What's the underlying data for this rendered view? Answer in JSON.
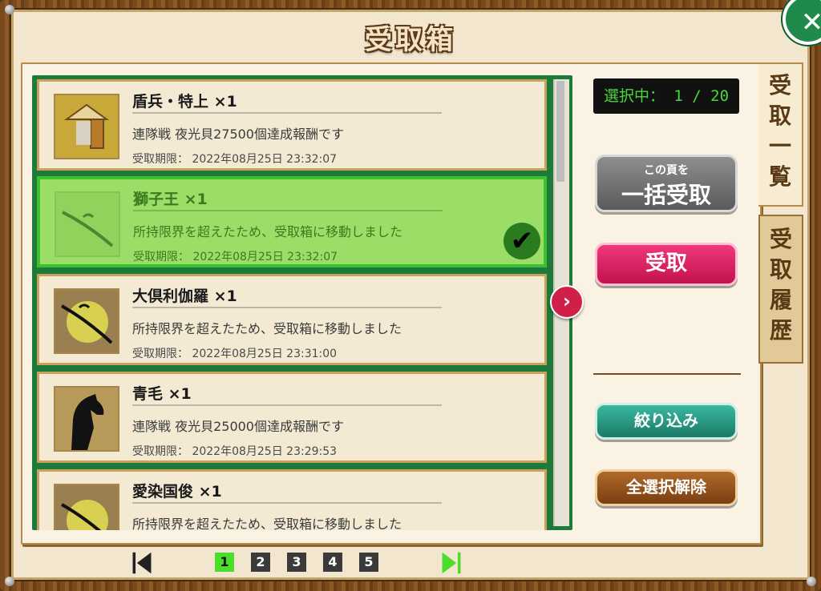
{
  "title": "受取箱",
  "close_icon": "close-x",
  "items": [
    {
      "name": "盾兵・特上",
      "qty": "×1",
      "desc": "連隊戦 夜光貝27500個達成報酬です",
      "expiry_label": "受取期限：",
      "expiry": "2022年08月25日 23:32:07",
      "icon": "shield-soldier",
      "selected": false
    },
    {
      "name": "獅子王",
      "qty": "×1",
      "desc": "所持限界を超えたため、受取箱に移動しました",
      "expiry_label": "受取期限：",
      "expiry": "2022年08月25日 23:32:07",
      "icon": "sword",
      "selected": true
    },
    {
      "name": "大倶利伽羅",
      "qty": "×1",
      "desc": "所持限界を超えたため、受取箱に移動しました",
      "expiry_label": "受取期限：",
      "expiry": "2022年08月25日 23:31:00",
      "icon": "sword",
      "selected": false
    },
    {
      "name": "青毛",
      "qty": "×1",
      "desc": "連隊戦 夜光貝25000個達成報酬です",
      "expiry_label": "受取期限：",
      "expiry": "2022年08月25日 23:29:53",
      "icon": "black-horse",
      "selected": false
    },
    {
      "name": "愛染国俊",
      "qty": "×1",
      "desc": "所持限界を超えたため、受取箱に移動しました",
      "expiry_label": "",
      "expiry": "",
      "icon": "sword",
      "selected": false
    }
  ],
  "counter": "選択中： 1 / 20",
  "buttons": {
    "bulk_small": "この頁を",
    "bulk_large": "一括受取",
    "receive": "受取",
    "filter": "絞り込み",
    "deselect_all": "全選択解除"
  },
  "tabs": {
    "list": [
      "受",
      "取",
      "一",
      "覧"
    ],
    "history": [
      "受",
      "取",
      "履",
      "歴"
    ]
  },
  "pager": {
    "pages": [
      "1",
      "2",
      "3",
      "4",
      "5"
    ],
    "current": "1"
  },
  "colors": {
    "selected_bg": "#9ade67",
    "receive_button": "#e0226a",
    "counter_text": "#49d83a"
  }
}
